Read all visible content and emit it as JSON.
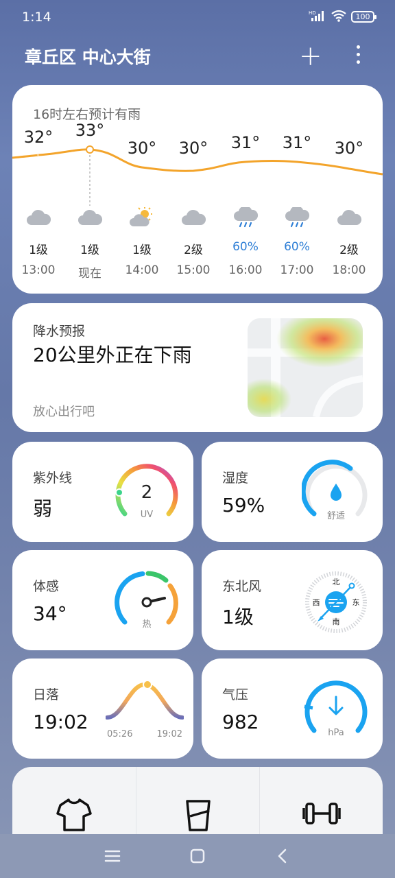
{
  "status": {
    "time": "1:14",
    "network": "HD",
    "battery": "100"
  },
  "header": {
    "location": "章丘区 中心大街"
  },
  "hourly": {
    "title": "16时左右预计有雨",
    "items": [
      {
        "temp": "32°",
        "icon": "cloudy-icon",
        "wind": "1级",
        "time": "13:00",
        "rain": false
      },
      {
        "temp": "33°",
        "icon": "cloudy-icon",
        "wind": "1级",
        "time": "现在",
        "rain": false
      },
      {
        "temp": "30°",
        "icon": "partly-sunny-icon",
        "wind": "1级",
        "time": "14:00",
        "rain": false
      },
      {
        "temp": "30°",
        "icon": "cloudy-icon",
        "wind": "2级",
        "time": "15:00",
        "rain": false
      },
      {
        "temp": "31°",
        "icon": "rain-icon",
        "wind": "60%",
        "time": "16:00",
        "rain": true
      },
      {
        "temp": "31°",
        "icon": "rain-icon",
        "wind": "60%",
        "time": "17:00",
        "rain": true
      },
      {
        "temp": "30°",
        "icon": "cloudy-icon",
        "wind": "2级",
        "time": "18:00",
        "rain": false
      }
    ]
  },
  "precip": {
    "title": "降水预报",
    "main": "20公里外正在下雨",
    "sub": "放心出行吧"
  },
  "uv": {
    "title": "紫外线",
    "value": "弱",
    "gauge_value": "2",
    "unit": "UV"
  },
  "humidity": {
    "title": "湿度",
    "value": "59%",
    "comfort": "舒适",
    "level": 0.59
  },
  "feels": {
    "title": "体感",
    "value": "34°",
    "label": "热"
  },
  "wind": {
    "title": "东北风",
    "value": "1级",
    "north": "北",
    "south": "南",
    "east": "东",
    "west": "西"
  },
  "sunset": {
    "title": "日落",
    "value": "19:02",
    "rise": "05:26",
    "set": "19:02"
  },
  "pressure": {
    "title": "气压",
    "value": "982",
    "unit": "hPa"
  },
  "bottom": {
    "icons": [
      "clothing-icon",
      "drink-icon",
      "fitness-icon"
    ]
  },
  "colors": {
    "accent": "#1aa3f0",
    "curve": "#f3a42b",
    "rain": "#2f7fd6"
  }
}
